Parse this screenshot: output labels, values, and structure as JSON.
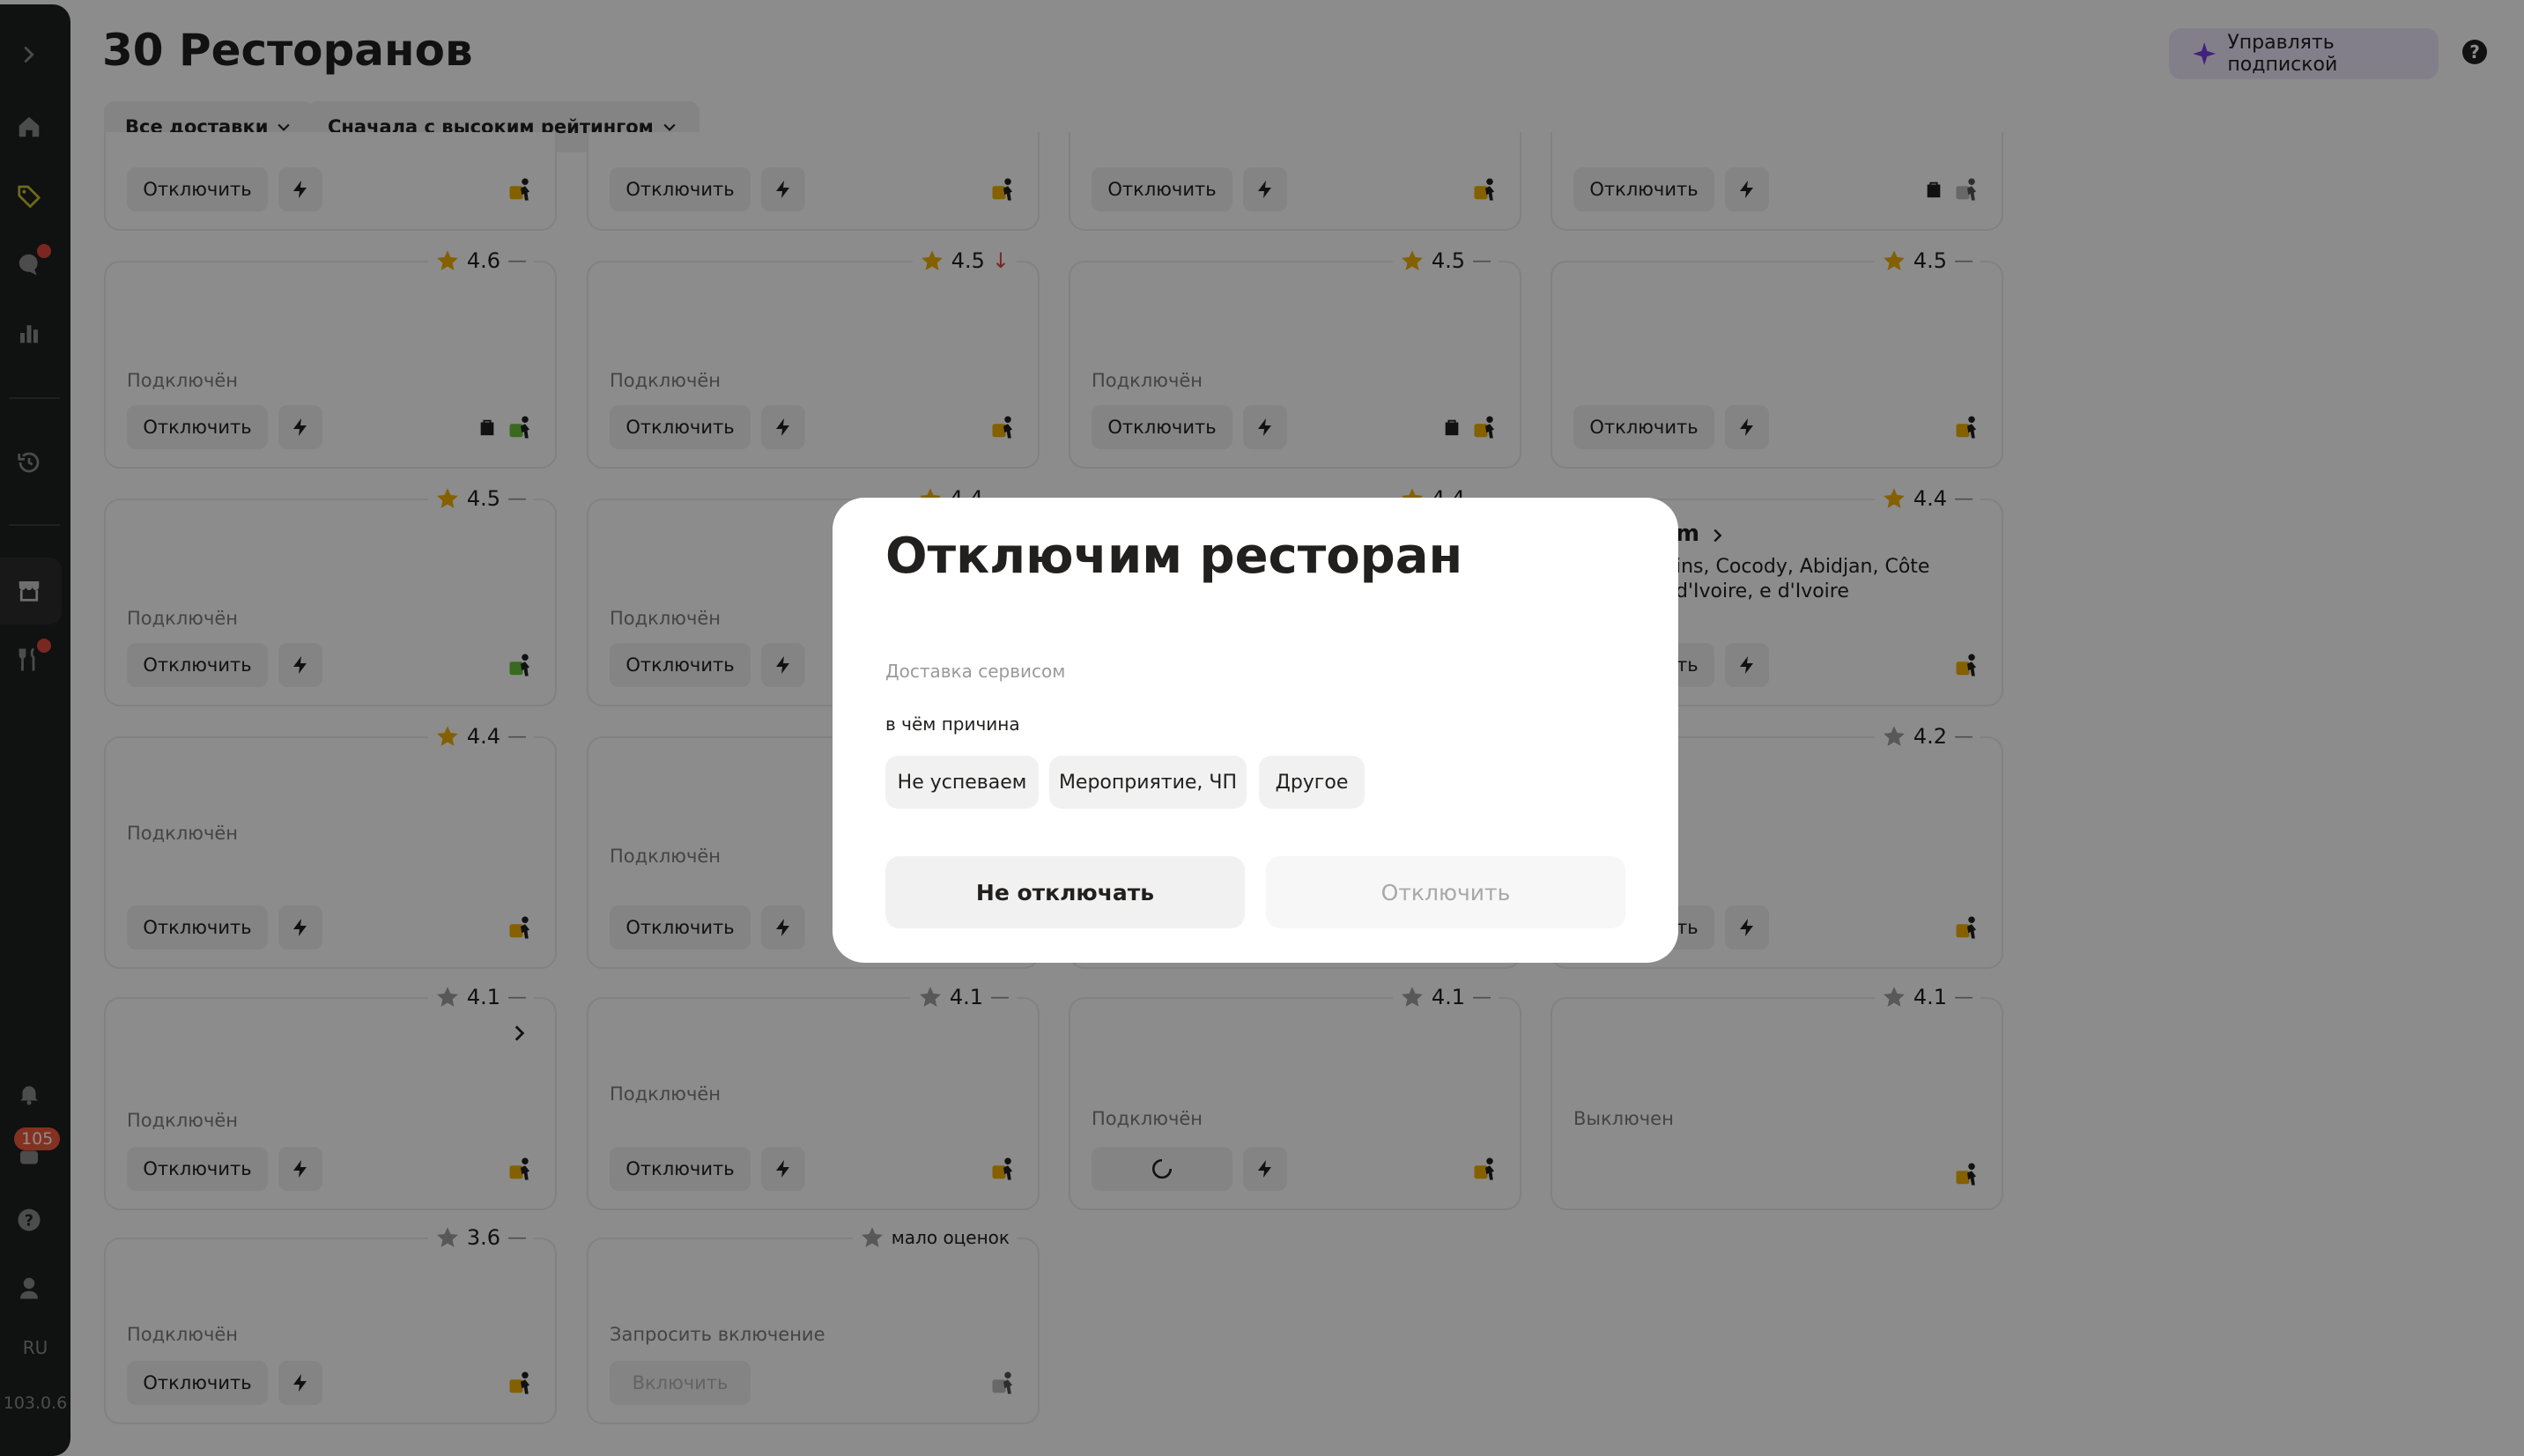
{
  "header": {
    "title": "30 Ресторанов",
    "subscription_button": "Управлять подпиской",
    "help_label": "?",
    "filters": [
      "Все доставки",
      "Сначала с высоким рейтингом"
    ]
  },
  "sidebar": {
    "notifications_count": "105",
    "language": "RU",
    "version": "103.0.6",
    "icons": [
      "chevron-right-icon",
      "home-icon",
      "tag-icon",
      "chat-icon",
      "chart-icon",
      "history-icon",
      "store-icon",
      "cutlery-icon",
      "bell-icon",
      "support-icon",
      "help-icon",
      "profile-icon"
    ]
  },
  "card_labels": {
    "disable": "Отключить",
    "enable": "Включить",
    "connected": "Подключён",
    "disabled": "Выключен",
    "request_enable": "Запросить включение",
    "few_ratings": "мало оценок"
  },
  "cards": {
    "r1c1": {
      "rating": "4.6",
      "trend": "—"
    },
    "r1c2": {
      "rating": "4.5",
      "trend": "↓"
    },
    "r1c3": {
      "rating": "4.5",
      "trend": "—"
    },
    "r1c4": {
      "rating": "4.5",
      "trend": "—"
    },
    "r2c1": {
      "rating": "4.5",
      "trend": "—"
    },
    "r2c2": {
      "rating": "4.4",
      "trend": "—"
    },
    "r2c3": {
      "rating": "4.4",
      "trend": "—"
    },
    "r2c4": {
      "rating": "4.4",
      "trend": "—",
      "name_fragment": "m",
      "address_fragment": "ins, Cocody, Abidjan, Côte d'Ivoire, e d'Ivoire"
    },
    "r3c1": {
      "rating": "4.4",
      "trend": "—"
    },
    "r3c4": {
      "rating": "4.2",
      "trend": "—"
    },
    "r4c1": {
      "rating": "4.1",
      "trend": "—"
    },
    "r4c2": {
      "rating": "4.1",
      "trend": "—"
    },
    "r4c3": {
      "rating": "4.1",
      "trend": "—"
    },
    "r4c4": {
      "rating": "4.1",
      "trend": "—"
    },
    "r5c1": {
      "rating": "3.6",
      "trend": "—"
    }
  },
  "modal": {
    "title": "Отключим ресторан",
    "subtitle": "Доставка сервисом",
    "question": "в чём причина",
    "reasons": [
      "Не успеваем",
      "Мероприятие, ЧП",
      "Другое"
    ],
    "cancel_label": "Не отключать",
    "confirm_label": "Отключить"
  },
  "colors": {
    "star_gold": "#f0b000",
    "star_gray": "#a0a0a0",
    "accent_purple": "#7b3fe4",
    "badge_red": "#f05a3e"
  }
}
